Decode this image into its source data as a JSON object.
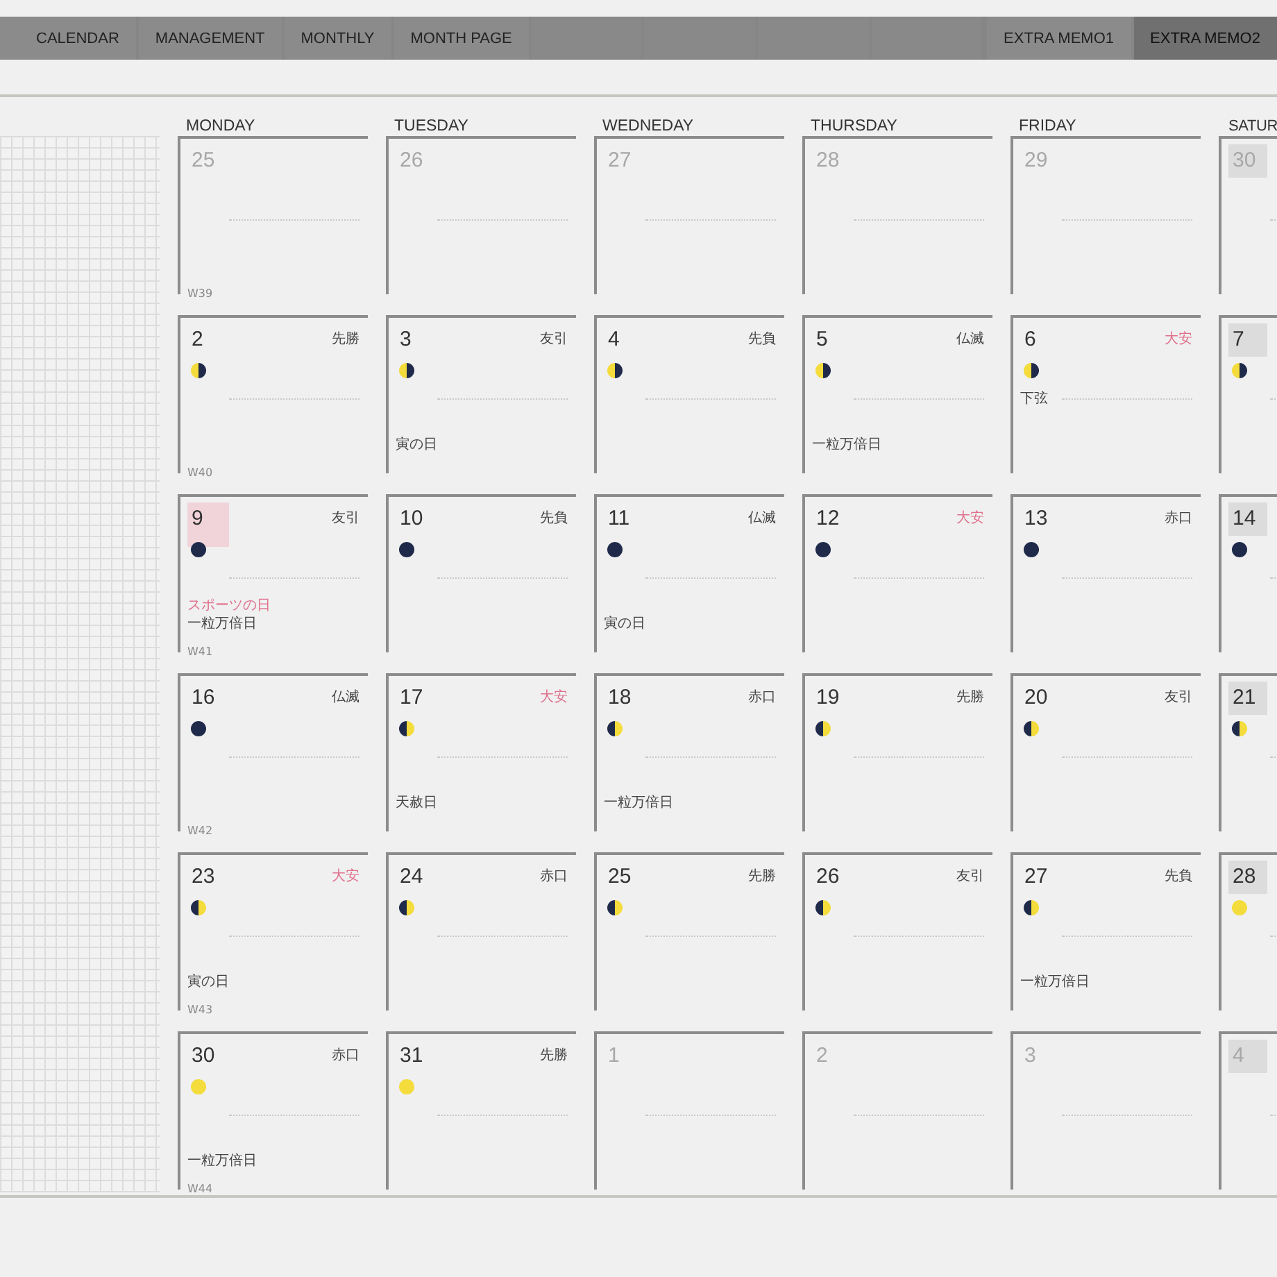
{
  "tabs": [
    {
      "label": "CALENDAR",
      "selected": false
    },
    {
      "label": "MANAGEMENT",
      "selected": false
    },
    {
      "label": "MONTHLY",
      "selected": false
    },
    {
      "label": "MONTH PAGE",
      "selected": false
    },
    {
      "label": "EXTRA MEMO1",
      "selected": false
    },
    {
      "label": "EXTRA MEMO2",
      "selected": true
    }
  ],
  "weekdays": [
    "MONDAY",
    "TUESDAY",
    "WEDNEDAY",
    "THURSDAY",
    "FRIDAY",
    "SATUR"
  ],
  "weeks": [
    {
      "week": "W39",
      "days": [
        {
          "date": "25",
          "muted": true,
          "weekend": false,
          "holiday": false
        },
        {
          "date": "26",
          "muted": true,
          "weekend": false,
          "holiday": false
        },
        {
          "date": "27",
          "muted": true,
          "weekend": false,
          "holiday": false
        },
        {
          "date": "28",
          "muted": true,
          "weekend": false,
          "holiday": false
        },
        {
          "date": "29",
          "muted": true,
          "weekend": false,
          "holiday": false
        },
        {
          "date": "30",
          "muted": true,
          "weekend": true,
          "holiday": false
        }
      ]
    },
    {
      "week": "W40",
      "days": [
        {
          "date": "2",
          "muted": false,
          "weekend": false,
          "holiday": false,
          "rokuyo": {
            "text": "先勝",
            "color": "#444444"
          },
          "moon": {
            "kind": "light-left"
          }
        },
        {
          "date": "3",
          "muted": false,
          "weekend": false,
          "holiday": false,
          "rokuyo": {
            "text": "友引",
            "color": "#444444"
          },
          "moon": {
            "kind": "light-left"
          },
          "events": [
            {
              "text": "寅の日",
              "color": "#444444"
            }
          ]
        },
        {
          "date": "4",
          "muted": false,
          "weekend": false,
          "holiday": false,
          "rokuyo": {
            "text": "先負",
            "color": "#444444"
          },
          "moon": {
            "kind": "light-left"
          }
        },
        {
          "date": "5",
          "muted": false,
          "weekend": false,
          "holiday": false,
          "rokuyo": {
            "text": "仏滅",
            "color": "#444444"
          },
          "moon": {
            "kind": "light-left"
          },
          "events": [
            {
              "text": "一粒万倍日",
              "color": "#444444"
            }
          ]
        },
        {
          "date": "6",
          "muted": false,
          "weekend": false,
          "holiday": false,
          "rokuyo": {
            "text": "大安",
            "color": "#e0708c"
          },
          "moon": {
            "kind": "light-left"
          },
          "moon_note": "下弦"
        },
        {
          "date": "7",
          "muted": false,
          "weekend": true,
          "holiday": false,
          "moon": {
            "kind": "light-left"
          }
        }
      ]
    },
    {
      "week": "W41",
      "days": [
        {
          "date": "9",
          "muted": false,
          "weekend": false,
          "holiday": true,
          "rokuyo": {
            "text": "友引",
            "color": "#444444"
          },
          "moon": {
            "kind": "dark"
          },
          "events": [
            {
              "text": "スポーツの日",
              "color": "#e0708c"
            },
            {
              "text": "一粒万倍日",
              "color": "#444444"
            }
          ]
        },
        {
          "date": "10",
          "muted": false,
          "weekend": false,
          "holiday": false,
          "rokuyo": {
            "text": "先負",
            "color": "#444444"
          },
          "moon": {
            "kind": "dark"
          }
        },
        {
          "date": "11",
          "muted": false,
          "weekend": false,
          "holiday": false,
          "rokuyo": {
            "text": "仏滅",
            "color": "#444444"
          },
          "moon": {
            "kind": "dark"
          },
          "events": [
            {
              "text": "寅の日",
              "color": "#444444"
            }
          ]
        },
        {
          "date": "12",
          "muted": false,
          "weekend": false,
          "holiday": false,
          "rokuyo": {
            "text": "大安",
            "color": "#e0708c"
          },
          "moon": {
            "kind": "dark"
          }
        },
        {
          "date": "13",
          "muted": false,
          "weekend": false,
          "holiday": false,
          "rokuyo": {
            "text": "赤口",
            "color": "#444444"
          },
          "moon": {
            "kind": "dark"
          }
        },
        {
          "date": "14",
          "muted": false,
          "weekend": true,
          "holiday": false,
          "moon": {
            "kind": "dark"
          }
        }
      ]
    },
    {
      "week": "W42",
      "days": [
        {
          "date": "16",
          "muted": false,
          "weekend": false,
          "holiday": false,
          "rokuyo": {
            "text": "仏滅",
            "color": "#444444"
          },
          "moon": {
            "kind": "dark"
          }
        },
        {
          "date": "17",
          "muted": false,
          "weekend": false,
          "holiday": false,
          "rokuyo": {
            "text": "大安",
            "color": "#e0708c"
          },
          "moon": {
            "kind": "light-right"
          },
          "events": [
            {
              "text": "天赦日",
              "color": "#444444"
            }
          ]
        },
        {
          "date": "18",
          "muted": false,
          "weekend": false,
          "holiday": false,
          "rokuyo": {
            "text": "赤口",
            "color": "#444444"
          },
          "moon": {
            "kind": "light-right"
          },
          "events": [
            {
              "text": "一粒万倍日",
              "color": "#444444"
            }
          ]
        },
        {
          "date": "19",
          "muted": false,
          "weekend": false,
          "holiday": false,
          "rokuyo": {
            "text": "先勝",
            "color": "#444444"
          },
          "moon": {
            "kind": "light-right"
          }
        },
        {
          "date": "20",
          "muted": false,
          "weekend": false,
          "holiday": false,
          "rokuyo": {
            "text": "友引",
            "color": "#444444"
          },
          "moon": {
            "kind": "light-right"
          }
        },
        {
          "date": "21",
          "muted": false,
          "weekend": true,
          "holiday": false,
          "moon": {
            "kind": "light-right"
          }
        }
      ]
    },
    {
      "week": "W43",
      "days": [
        {
          "date": "23",
          "muted": false,
          "weekend": false,
          "holiday": false,
          "rokuyo": {
            "text": "大安",
            "color": "#e0708c"
          },
          "moon": {
            "kind": "light-right"
          },
          "events": [
            {
              "text": "寅の日",
              "color": "#444444"
            }
          ]
        },
        {
          "date": "24",
          "muted": false,
          "weekend": false,
          "holiday": false,
          "rokuyo": {
            "text": "赤口",
            "color": "#444444"
          },
          "moon": {
            "kind": "light-right"
          }
        },
        {
          "date": "25",
          "muted": false,
          "weekend": false,
          "holiday": false,
          "rokuyo": {
            "text": "先勝",
            "color": "#444444"
          },
          "moon": {
            "kind": "light-right"
          }
        },
        {
          "date": "26",
          "muted": false,
          "weekend": false,
          "holiday": false,
          "rokuyo": {
            "text": "友引",
            "color": "#444444"
          },
          "moon": {
            "kind": "light-right"
          }
        },
        {
          "date": "27",
          "muted": false,
          "weekend": false,
          "holiday": false,
          "rokuyo": {
            "text": "先負",
            "color": "#444444"
          },
          "moon": {
            "kind": "light-right"
          },
          "events": [
            {
              "text": "一粒万倍日",
              "color": "#444444"
            }
          ]
        },
        {
          "date": "28",
          "muted": false,
          "weekend": true,
          "holiday": false,
          "moon": {
            "kind": "full"
          }
        }
      ]
    },
    {
      "week": "W44",
      "days": [
        {
          "date": "30",
          "muted": false,
          "weekend": false,
          "holiday": false,
          "rokuyo": {
            "text": "赤口",
            "color": "#444444"
          },
          "moon": {
            "kind": "full"
          },
          "events": [
            {
              "text": "一粒万倍日",
              "color": "#444444"
            }
          ]
        },
        {
          "date": "31",
          "muted": false,
          "weekend": false,
          "holiday": false,
          "rokuyo": {
            "text": "先勝",
            "color": "#444444"
          },
          "moon": {
            "kind": "full"
          }
        },
        {
          "date": "1",
          "muted": true,
          "weekend": false,
          "holiday": false
        },
        {
          "date": "2",
          "muted": true,
          "weekend": false,
          "holiday": false
        },
        {
          "date": "3",
          "muted": true,
          "weekend": false,
          "holiday": false
        },
        {
          "date": "4",
          "muted": true,
          "weekend": true,
          "holiday": false
        }
      ]
    }
  ]
}
